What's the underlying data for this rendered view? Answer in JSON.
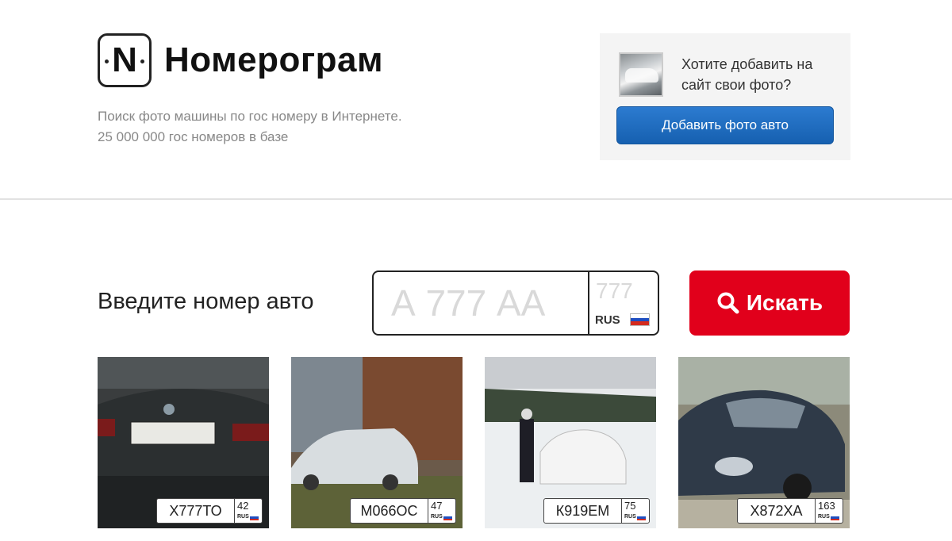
{
  "header": {
    "logo_letter": "N",
    "site_name": "Номерограм",
    "tagline_line1": "Поиск фото машины по гос номеру в Интернете.",
    "tagline_line2": "25 000 000 гос номеров в базе"
  },
  "promo": {
    "question_line1": "Хотите добавить на",
    "question_line2": "сайт свои фото?",
    "button_label": "Добавить фото авто"
  },
  "search": {
    "label": "Введите номер авто",
    "number_placeholder": "А 777 АА",
    "region_placeholder": "777",
    "country_code": "RUS",
    "button_label": "Искать",
    "button_color": "#e1001b"
  },
  "flag_colors": [
    "#ffffff",
    "#1f4fc1",
    "#d52b1e"
  ],
  "gallery": [
    {
      "number": "Х777ТО",
      "region": "42",
      "country": "RUS"
    },
    {
      "number": "М066ОС",
      "region": "47",
      "country": "RUS"
    },
    {
      "number": "К919ЕМ",
      "region": "75",
      "country": "RUS"
    },
    {
      "number": "Х872ХА",
      "region": "163",
      "country": "RUS"
    }
  ]
}
